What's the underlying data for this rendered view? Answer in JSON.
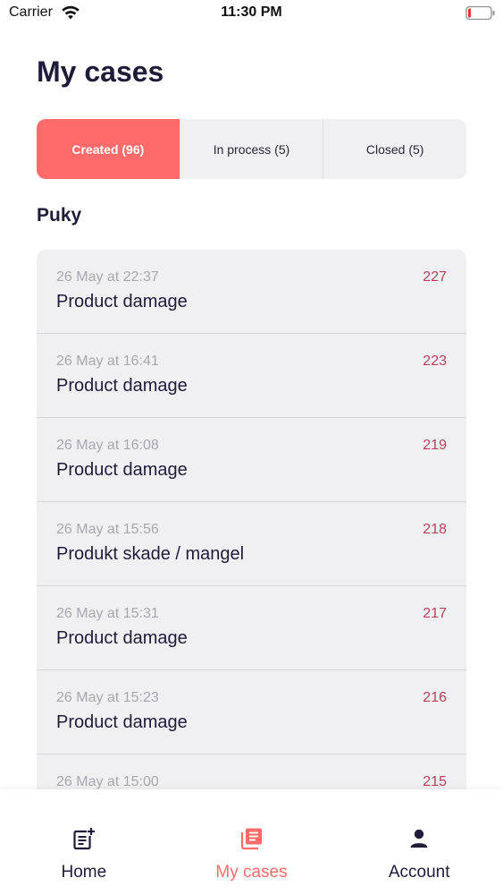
{
  "status_bar": {
    "carrier": "Carrier",
    "time": "11:30 PM"
  },
  "page": {
    "title": "My cases"
  },
  "tabs": [
    {
      "label": "Created (96)",
      "active": true
    },
    {
      "label": "In process (5)",
      "active": false
    },
    {
      "label": "Closed (5)",
      "active": false
    }
  ],
  "section": {
    "title": "Puky"
  },
  "cases": [
    {
      "date": "26 May at 22:37",
      "number": "227",
      "title": "Product damage"
    },
    {
      "date": "26 May at 16:41",
      "number": "223",
      "title": "Product damage"
    },
    {
      "date": "26 May at 16:08",
      "number": "219",
      "title": "Product damage"
    },
    {
      "date": "26 May at 15:56",
      "number": "218",
      "title": "Produkt skade / mangel"
    },
    {
      "date": "26 May at 15:31",
      "number": "217",
      "title": "Product damage"
    },
    {
      "date": "26 May at 15:23",
      "number": "216",
      "title": "Product damage"
    },
    {
      "date": "26 May at 15:00",
      "number": "215",
      "title": ""
    }
  ],
  "tab_bar": [
    {
      "label": "Home",
      "icon": "add-note-icon",
      "active": false
    },
    {
      "label": "My cases",
      "icon": "cases-stack-icon",
      "active": true
    },
    {
      "label": "Account",
      "icon": "person-icon",
      "active": false
    }
  ],
  "colors": {
    "accent": "#ff6b6b",
    "case_number": "#b4435b",
    "text_dark": "#1f1c3a",
    "text_muted": "#a7a7b0",
    "card_bg": "#f0f0f2"
  }
}
